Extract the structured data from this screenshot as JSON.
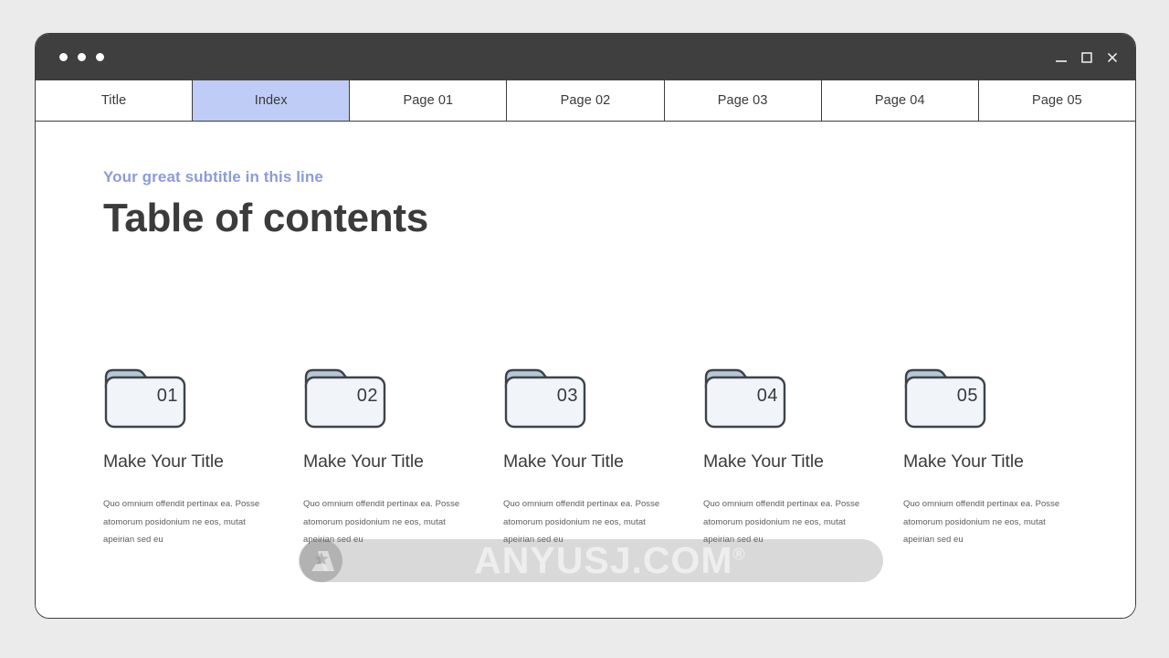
{
  "window": {
    "traffic_dots": [
      "dot-1",
      "dot-2",
      "dot-3"
    ],
    "controls": [
      {
        "name": "minimize",
        "glyph": "_"
      },
      {
        "name": "maximize",
        "glyph": "□"
      },
      {
        "name": "close",
        "glyph": "×"
      }
    ]
  },
  "tabs": [
    {
      "label": "Title",
      "active": false
    },
    {
      "label": "Index",
      "active": true
    },
    {
      "label": "Page 01",
      "active": false
    },
    {
      "label": "Page 02",
      "active": false
    },
    {
      "label": "Page 03",
      "active": false
    },
    {
      "label": "Page 04",
      "active": false
    },
    {
      "label": "Page 05",
      "active": false
    }
  ],
  "slide": {
    "subtitle": "Your great subtitle in this line",
    "title": "Table of contents",
    "items": [
      {
        "number": "01",
        "title": "Make Your Title",
        "body": "Quo omnium offendit pertinax ea. Posse atomorum posidonium ne eos, mutat apeirian sed eu"
      },
      {
        "number": "02",
        "title": "Make Your Title",
        "body": "Quo omnium offendit pertinax ea. Posse atomorum posidonium ne eos, mutat apeirian sed eu"
      },
      {
        "number": "03",
        "title": "Make Your Title",
        "body": "Quo omnium offendit pertinax ea. Posse atomorum posidonium ne eos, mutat apeirian sed eu"
      },
      {
        "number": "04",
        "title": "Make Your Title",
        "body": "Quo omnium offendit pertinax ea. Posse atomorum posidonium ne eos, mutat apeirian sed eu"
      },
      {
        "number": "05",
        "title": "Make Your Title",
        "body": "Quo omnium offendit pertinax ea. Posse atomorum posidonium ne eos, mutat apeirian sed eu"
      }
    ]
  },
  "watermark": {
    "text": "ANYUSJ.COM",
    "registered_mark": "®"
  },
  "colors": {
    "page_background": "#ebebeb",
    "titlebar": "#3f3f3f",
    "active_tab": "#bfccf5",
    "subtitle": "#8b9cd9",
    "heading": "#3b3b3b",
    "folder_fill": "#f1f5f9",
    "folder_tab": "#b7c6d6",
    "folder_stroke": "#3d434a",
    "body_text": "#5c5c5c"
  }
}
